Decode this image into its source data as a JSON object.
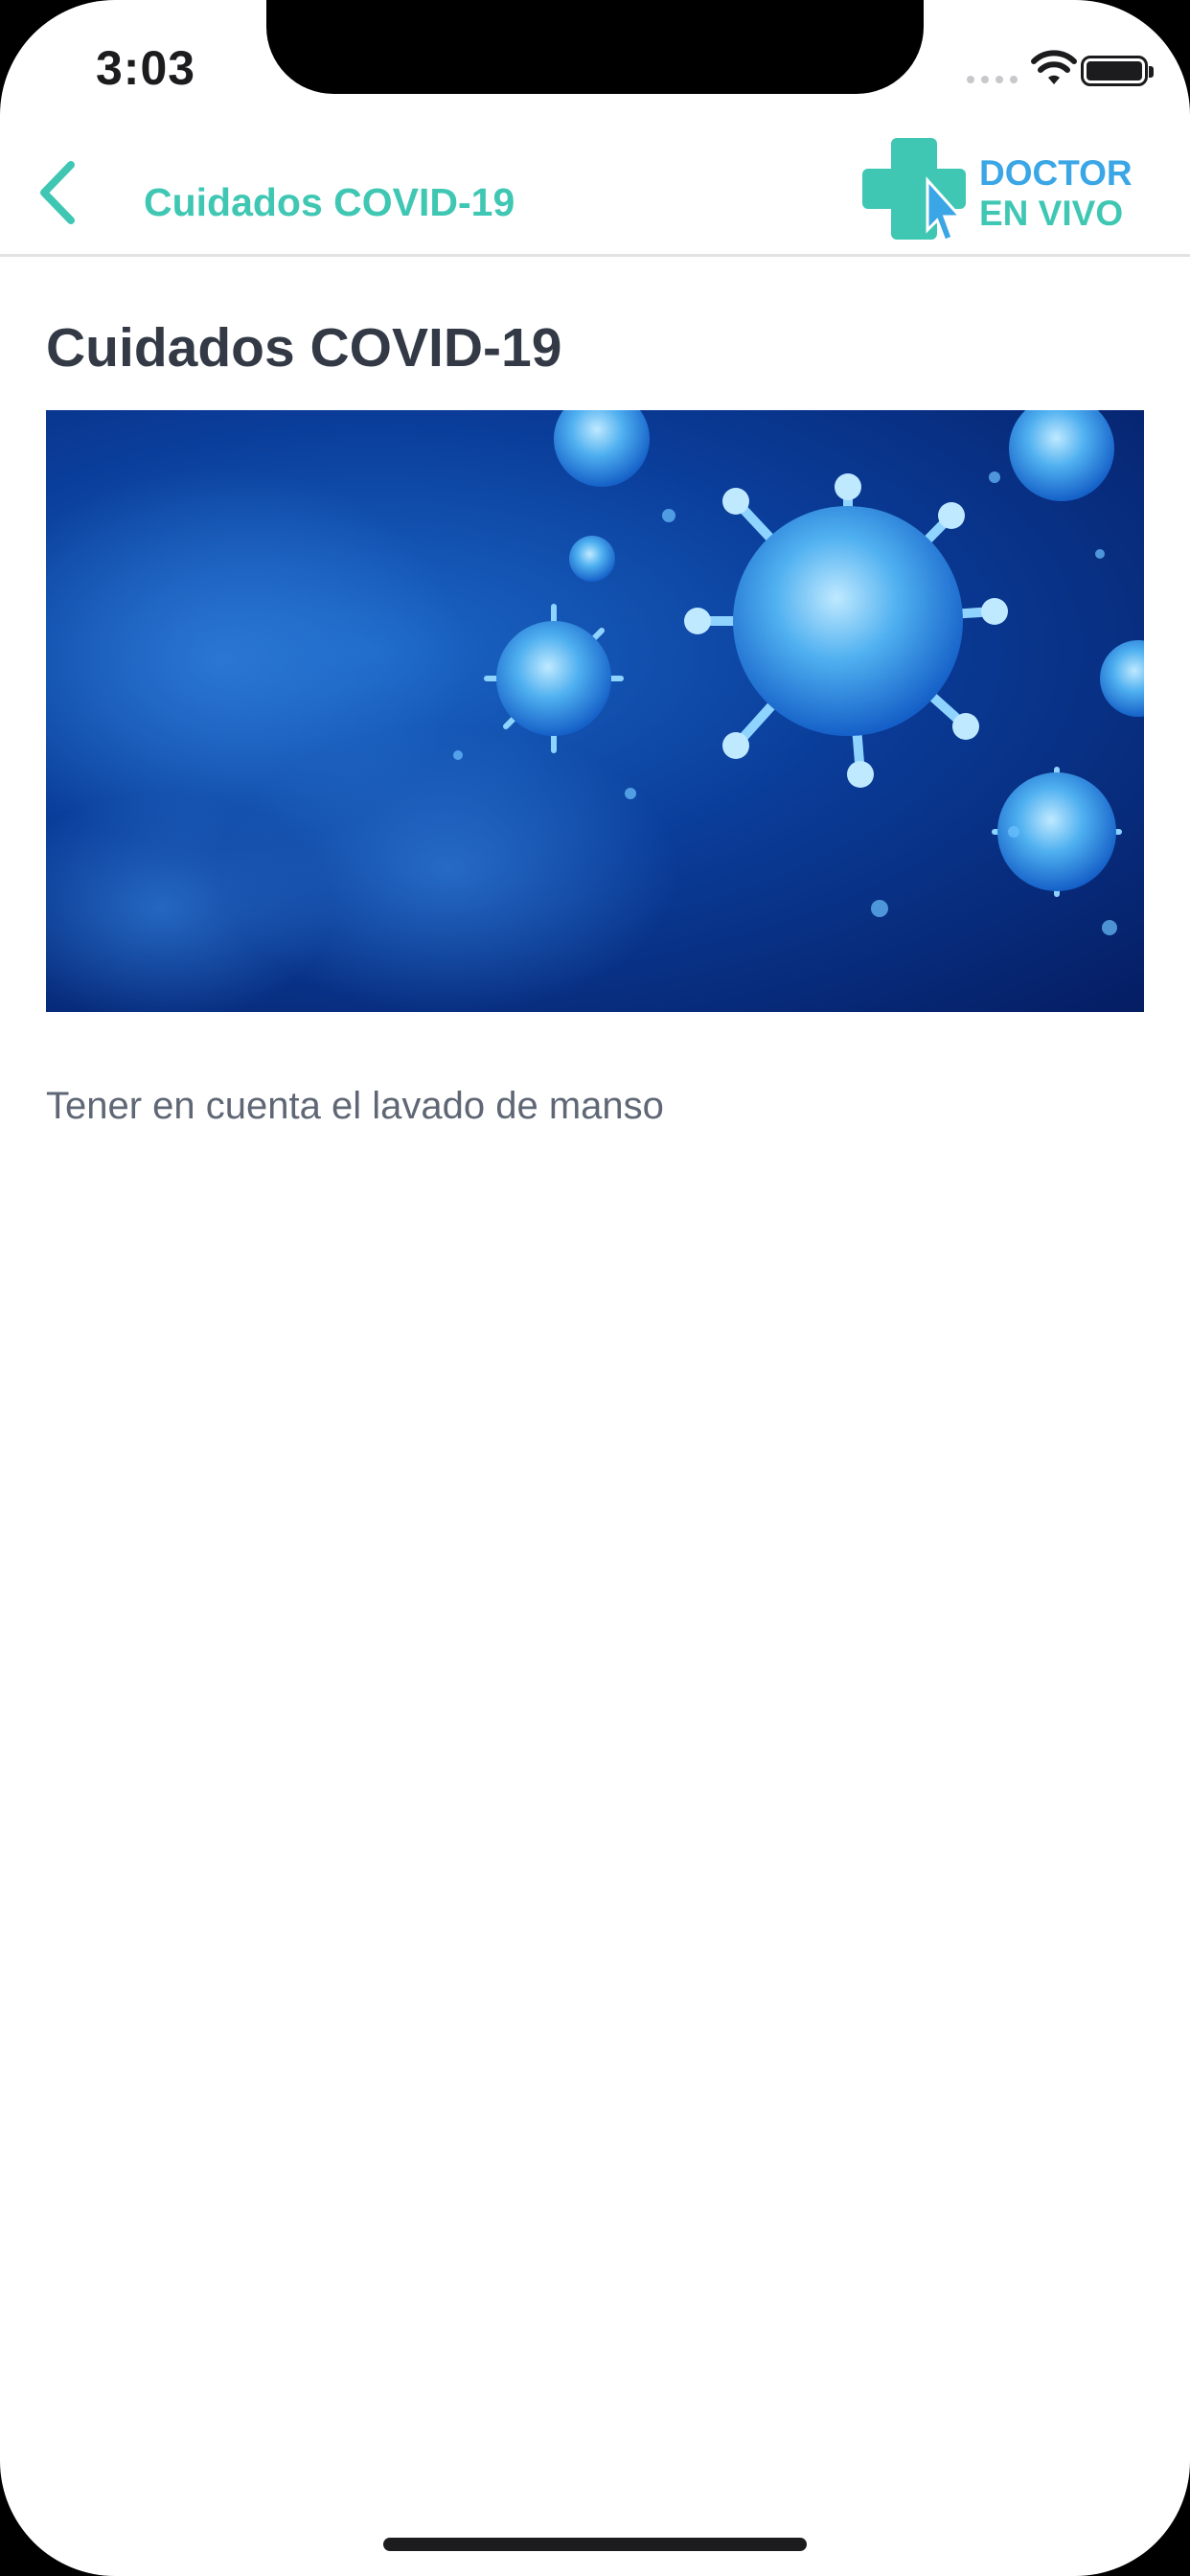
{
  "status_bar": {
    "time": "3:03"
  },
  "nav": {
    "title": "Cuidados COVID-19",
    "brand_line1": "DOCTOR",
    "brand_line2": "EN VIVO"
  },
  "article": {
    "title": "Cuidados COVID-19",
    "image_alt": "coronavirus-illustration",
    "body": "Tener en cuenta el lavado de manso"
  },
  "colors": {
    "accent_teal": "#3fc7b4",
    "brand_blue": "#3aa6e6",
    "title_text": "#333a46",
    "body_text": "#5f6775"
  },
  "icons": {
    "back": "chevron-left-icon",
    "wifi": "wifi-icon",
    "battery": "battery-icon",
    "signal": "signal-icon",
    "brand": "medical-cross-logo"
  }
}
